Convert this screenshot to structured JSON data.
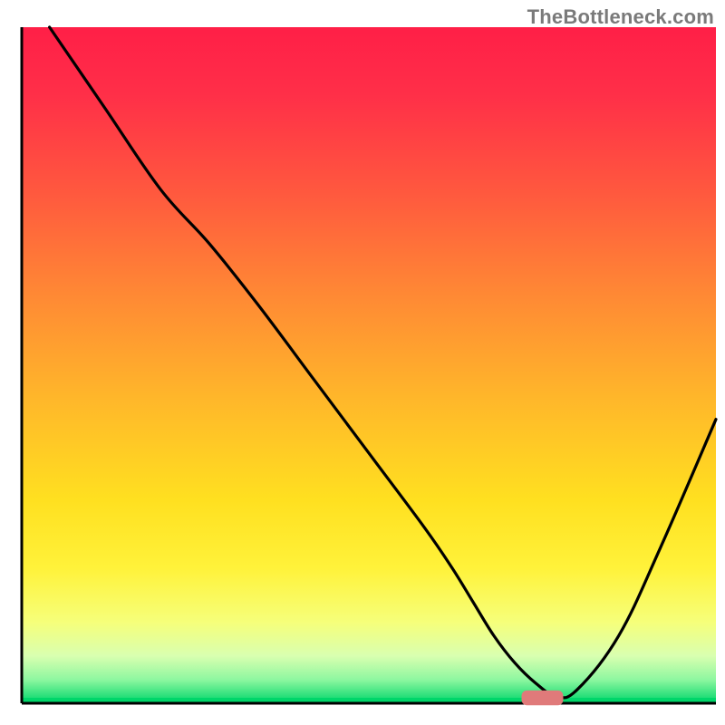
{
  "watermark": "TheBottleneck.com",
  "chart_data": {
    "type": "line",
    "title": "",
    "xlabel": "",
    "ylabel": "",
    "xlim": [
      0,
      100
    ],
    "ylim": [
      0,
      100
    ],
    "background_gradient": {
      "stops": [
        {
          "offset": 0.0,
          "color": "#ff1f47"
        },
        {
          "offset": 0.1,
          "color": "#ff2f48"
        },
        {
          "offset": 0.25,
          "color": "#ff5a3e"
        },
        {
          "offset": 0.4,
          "color": "#ff8a34"
        },
        {
          "offset": 0.55,
          "color": "#ffb72a"
        },
        {
          "offset": 0.7,
          "color": "#ffe020"
        },
        {
          "offset": 0.8,
          "color": "#fff23a"
        },
        {
          "offset": 0.88,
          "color": "#f6ff7a"
        },
        {
          "offset": 0.93,
          "color": "#d9ffb0"
        },
        {
          "offset": 0.965,
          "color": "#8ef7a0"
        },
        {
          "offset": 1.0,
          "color": "#00d66a"
        }
      ]
    },
    "series": [
      {
        "name": "bottleneck-curve",
        "color": "#000000",
        "x": [
          4,
          12,
          20,
          27,
          34,
          42,
          50,
          58,
          62,
          65,
          68,
          71,
          74,
          77,
          80,
          86,
          92,
          100
        ],
        "y": [
          100,
          88,
          76,
          68,
          59,
          48,
          37,
          26,
          20,
          15,
          10,
          6,
          3,
          1,
          2,
          10,
          23,
          42
        ]
      }
    ],
    "marker": {
      "name": "optimal-range",
      "color": "#e07a7a",
      "x_start": 72,
      "x_end": 78,
      "y": 0.8,
      "thickness": 2.2
    },
    "axes": {
      "left": {
        "show": true,
        "color": "#000000",
        "width": 3
      },
      "bottom": {
        "show": true,
        "color": "#000000",
        "width": 3
      }
    }
  }
}
